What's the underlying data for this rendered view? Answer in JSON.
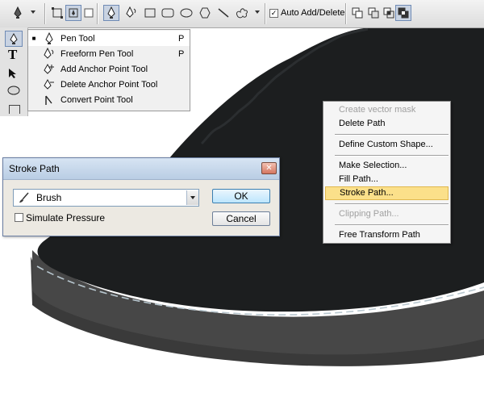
{
  "options_bar": {
    "auto_add_delete_label": "Auto Add/Delete",
    "auto_add_delete_checked": true
  },
  "flyout": {
    "items": [
      {
        "label": "Pen Tool",
        "key": "P",
        "selected": true,
        "icon": "pen-icon"
      },
      {
        "label": "Freeform Pen Tool",
        "key": "P",
        "selected": false,
        "icon": "freeform-pen-icon"
      },
      {
        "label": "Add Anchor Point Tool",
        "key": "",
        "selected": false,
        "icon": "add-anchor-icon"
      },
      {
        "label": "Delete Anchor Point Tool",
        "key": "",
        "selected": false,
        "icon": "delete-anchor-icon"
      },
      {
        "label": "Convert Point Tool",
        "key": "",
        "selected": false,
        "icon": "convert-point-icon"
      }
    ],
    "bullet": "■"
  },
  "context_menu": {
    "items": [
      {
        "label": "Create vector mask",
        "disabled": true
      },
      {
        "label": "Delete Path",
        "disabled": false
      },
      {
        "label": "Define Custom Shape...",
        "disabled": false
      },
      {
        "label": "Make Selection...",
        "disabled": false
      },
      {
        "label": "Fill Path...",
        "disabled": false
      },
      {
        "label": "Stroke Path...",
        "disabled": false,
        "highlighted": true
      },
      {
        "label": "Clipping Path...",
        "disabled": true
      },
      {
        "label": "Free Transform Path",
        "disabled": false
      }
    ]
  },
  "dialog": {
    "title": "Stroke Path",
    "tool_value": "Brush",
    "simulate_pressure_label": "Simulate Pressure",
    "simulate_pressure_checked": false,
    "ok_label": "OK",
    "cancel_label": "Cancel",
    "close_glyph": "✕"
  },
  "toolbar": {
    "type_glyph": "T"
  },
  "colors": {
    "shoe_upper": "#1c1e1f",
    "shoe_sole": "#454545",
    "highlight": "#fbe08a",
    "dialog_bg": "#ece9e2"
  }
}
